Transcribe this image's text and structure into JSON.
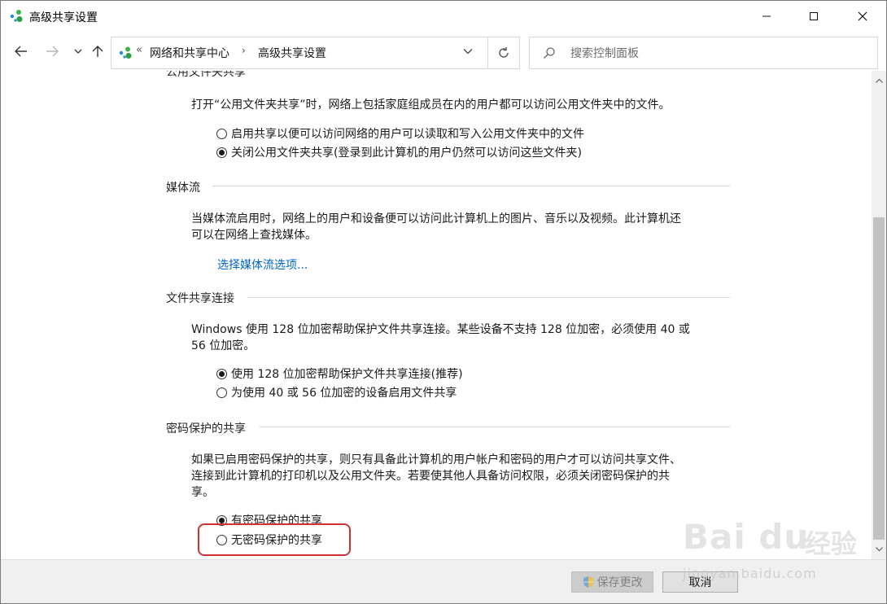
{
  "window": {
    "title": "高级共享设置",
    "controls": {
      "minimize": "—",
      "maximize": "☐",
      "close": "✕"
    }
  },
  "nav": {
    "back_icon": "left-arrow-icon",
    "forward_icon": "right-arrow-icon",
    "recent_icon": "chevron-down-icon",
    "up_icon": "up-arrow-icon",
    "address": {
      "chevron": "«",
      "crumbs": [
        "网络和共享中心",
        "高级共享设置"
      ],
      "separator": "›"
    },
    "refresh_icon": "refresh-icon",
    "search_placeholder": "搜索控制面板"
  },
  "sections": {
    "public_folder": {
      "heading": "公用文件夹共享",
      "description": "打开“公用文件夹共享”时，网络上包括家庭组成员在内的用户都可以访问公用文件夹中的文件。",
      "options": [
        {
          "label": "启用共享以便可以访问网络的用户可以读取和写入公用文件夹中的文件",
          "selected": false
        },
        {
          "label": "关闭公用文件夹共享(登录到此计算机的用户仍然可以访问这些文件夹)",
          "selected": true
        }
      ]
    },
    "media": {
      "heading": "媒体流",
      "description_line1": "当媒体流启用时，网络上的用户和设备便可以访问此计算机上的图片、音乐以及视频。此计算机还",
      "description_line2": "可以在网络上查找媒体。",
      "link": "选择媒体流选项..."
    },
    "file_sharing": {
      "heading": "文件共享连接",
      "description_line1": "Windows 使用 128 位加密帮助保护文件共享连接。某些设备不支持 128 位加密，必须使用 40 或",
      "description_line2": "56 位加密。",
      "options": [
        {
          "label": "使用 128 位加密帮助保护文件共享连接(推荐)",
          "selected": true
        },
        {
          "label": "为使用 40 或 56 位加密的设备启用文件共享",
          "selected": false
        }
      ]
    },
    "password": {
      "heading": "密码保护的共享",
      "description_line1": "如果已启用密码保护的共享，则只有具备此计算机的用户帐户和密码的用户才可以访问共享文件、",
      "description_line2": "连接到此计算机的打印机以及公用文件夹。若要使其他人具备访问权限，必须关闭密码保护的共",
      "description_line3": "享。",
      "options": [
        {
          "label": "有密码保护的共享",
          "selected": true
        },
        {
          "label": "无密码保护的共享",
          "selected": false
        }
      ]
    }
  },
  "footer": {
    "save_label": "保存更改",
    "cancel_label": "取消"
  },
  "watermark": {
    "brand": "Bai du",
    "cn": "经验",
    "url": "jingyan.baidu.com"
  },
  "colors": {
    "link": "#0066cc",
    "highlight": "#cc3333",
    "scrollbar_thumb": "#c1c1c1"
  }
}
